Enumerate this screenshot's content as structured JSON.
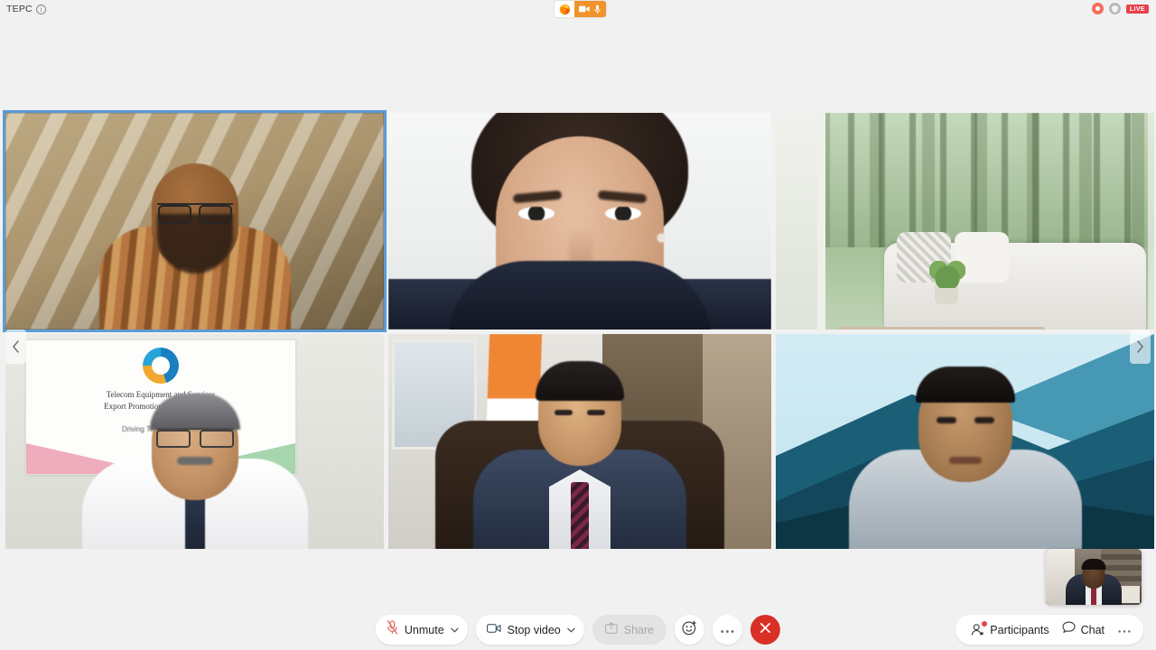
{
  "app": {
    "meeting_title": "TEPC",
    "info_icon": "info-icon",
    "background_color": "#f1f1f1"
  },
  "browser_indicator": {
    "browser_icon": "firefox-logo-icon",
    "camera_icon": "camera-sharing-icon",
    "microphone_icon": "microphone-sharing-icon",
    "accent_color": "#f0932b"
  },
  "status_bar": {
    "recording_icon": "recording-indicator-icon",
    "shield_icon": "shield-indicator-icon",
    "live_label": "LIVE",
    "live_color": "#e8414a"
  },
  "gallery": {
    "prev_icon": "chevron-left-icon",
    "next_icon": "chevron-right-icon",
    "active_speaker_color": "#5b9bd5",
    "tiles": [
      {
        "position": "top-left",
        "scene": "man-with-glasses-warm-room",
        "active_speaker": true
      },
      {
        "position": "top-center",
        "scene": "woman-white-background",
        "active_speaker": false
      },
      {
        "position": "top-right",
        "scene": "virtual-background-forest-sofa",
        "active_speaker": false
      },
      {
        "position": "bottom-left",
        "scene": "man-with-tepc-poster",
        "active_speaker": false
      },
      {
        "position": "bottom-center",
        "scene": "man-with-indian-flag",
        "active_speaker": false
      },
      {
        "position": "bottom-right",
        "scene": "man-teal-geometric-background",
        "active_speaker": false
      }
    ],
    "poster": {
      "line1": "Telecom Equipment and Services",
      "line2": "Export Promotion Council (TEPC)",
      "line3": "Driving Telecom Exports"
    }
  },
  "self_view": {
    "name": "self-view-thumbnail",
    "scene": "man-in-suit-office"
  },
  "toolbar": {
    "audio": {
      "label": "Unmute",
      "icon": "microphone-muted-icon",
      "caret_icon": "chevron-down-icon",
      "muted": true
    },
    "video": {
      "label": "Stop video",
      "icon": "camera-icon",
      "caret_icon": "chevron-down-icon"
    },
    "share": {
      "label": "Share",
      "icon": "share-screen-icon",
      "disabled": true
    },
    "reactions": {
      "icon": "emoji-reaction-icon"
    },
    "more": {
      "icon": "more-horizontal-icon"
    },
    "leave": {
      "icon": "close-icon",
      "color": "#d93025"
    },
    "participants": {
      "label": "Participants",
      "icon": "participants-icon",
      "has_notification": true
    },
    "chat": {
      "label": "Chat",
      "icon": "chat-bubble-icon"
    },
    "overflow": {
      "icon": "more-horizontal-icon"
    }
  }
}
